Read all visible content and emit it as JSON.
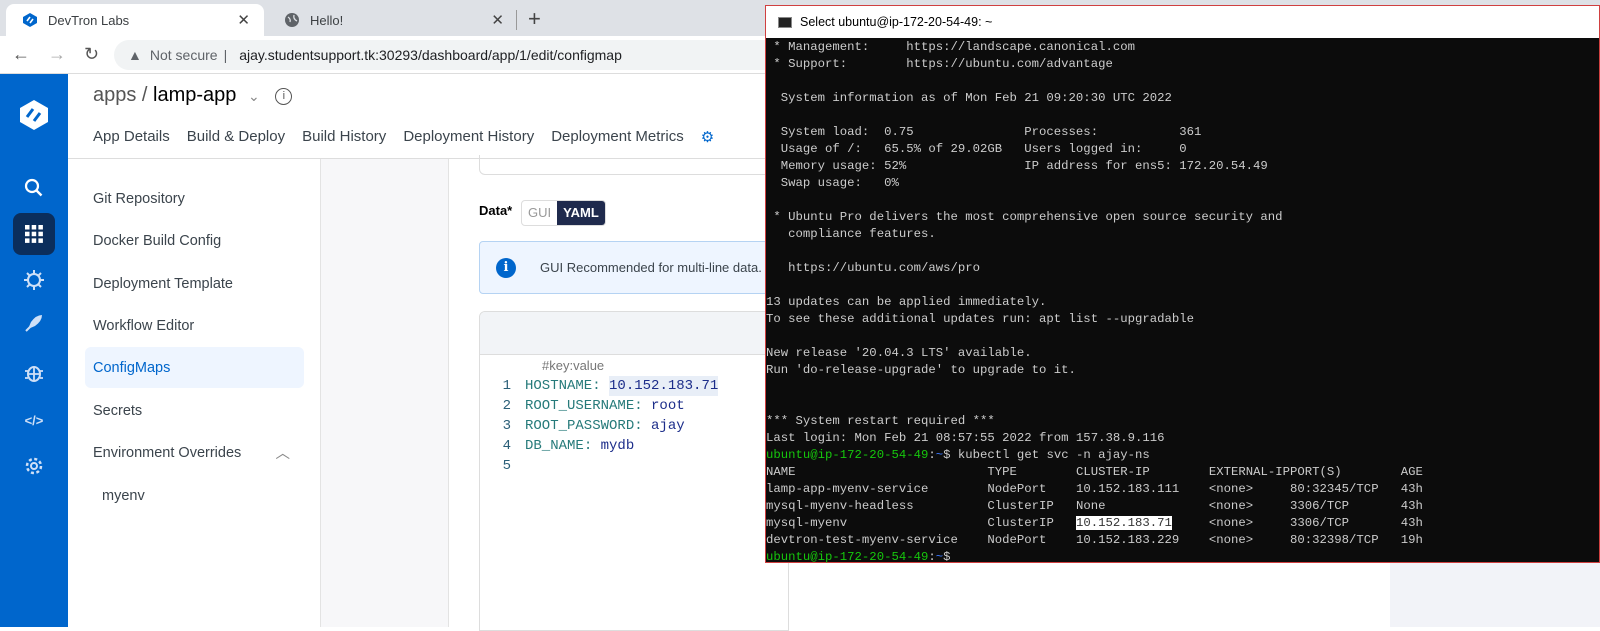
{
  "browser": {
    "tabs": [
      {
        "label": "DevTron Labs",
        "active": true
      },
      {
        "label": "Hello!",
        "active": false
      }
    ],
    "security": "Not secure",
    "url": "ajay.studentsupport.tk:30293/dashboard/app/1/edit/configmap"
  },
  "header": {
    "breadcrumb_prefix": "apps / ",
    "app_name": "lamp-app",
    "tabs": [
      "App Details",
      "Build & Deploy",
      "Build History",
      "Deployment History",
      "Deployment Metrics"
    ]
  },
  "sidebar": {
    "items": [
      "Git Repository",
      "Docker Build Config",
      "Deployment Template",
      "Workflow Editor",
      "ConfigMaps",
      "Secrets",
      "Environment Overrides",
      "myenv"
    ],
    "selected": "ConfigMaps"
  },
  "configmap": {
    "data_label": "Data*",
    "toggle": [
      "GUI",
      "YAML"
    ],
    "toggle_selected": "YAML",
    "info": "GUI Recommended for multi-line data.",
    "comment": "#key:value",
    "lines": [
      {
        "n": "1",
        "key": "HOSTNAME",
        "value": "10.152.183.71"
      },
      {
        "n": "2",
        "key": "ROOT_USERNAME",
        "value": "root"
      },
      {
        "n": "3",
        "key": "ROOT_PASSWORD",
        "value": "ajay"
      },
      {
        "n": "4",
        "key": "DB_NAME",
        "value": "mydb"
      },
      {
        "n": "5",
        "key": "",
        "value": ""
      }
    ]
  },
  "terminal": {
    "title": "Select ubuntu@ip-172-20-54-49: ~",
    "prompt_user": "ubuntu@ip-172-20-54-49",
    "prompt_path": "~",
    "lines": [
      " * Management:     https://landscape.canonical.com",
      " * Support:        https://ubuntu.com/advantage",
      "",
      "  System information as of Mon Feb 21 09:20:30 UTC 2022",
      "",
      "  System load:  0.75               Processes:           361",
      "  Usage of /:   65.5% of 29.02GB   Users logged in:     0",
      "  Memory usage: 52%                IP address for ens5: 172.20.54.49",
      "  Swap usage:   0%",
      "",
      " * Ubuntu Pro delivers the most comprehensive open source security and",
      "   compliance features.",
      "",
      "   https://ubuntu.com/aws/pro",
      "",
      "13 updates can be applied immediately.",
      "To see these additional updates run: apt list --upgradable",
      "",
      "New release '20.04.3 LTS' available.",
      "Run 'do-release-upgrade' to upgrade to it.",
      "",
      "",
      "*** System restart required ***",
      "Last login: Mon Feb 21 08:57:55 2022 from 157.38.9.116"
    ],
    "command": "kubectl get svc -n ajay-ns",
    "svc_columns": [
      "NAME",
      "TYPE",
      "CLUSTER-IP",
      "EXTERNAL-IP",
      "PORT(S)",
      "AGE"
    ],
    "svc_rows": [
      [
        "lamp-app-myenv-service",
        "NodePort",
        "10.152.183.111",
        "<none>",
        "80:32345/TCP",
        "43h"
      ],
      [
        "mysql-myenv-headless",
        "ClusterIP",
        "None",
        "<none>",
        "3306/TCP",
        "43h"
      ],
      [
        "mysql-myenv",
        "ClusterIP",
        "10.152.183.71",
        "<none>",
        "3306/TCP",
        "43h"
      ],
      [
        "devtron-test-myenv-service",
        "NodePort",
        "10.152.183.229",
        "<none>",
        "80:32398/TCP",
        "19h"
      ]
    ],
    "selected_text": "10.152.183.71"
  },
  "colors": {
    "brand": "#0066cc",
    "nav_selected": "#0b2e5c",
    "prompt_green": "#16c60c",
    "prompt_blue": "#3b78ff"
  }
}
